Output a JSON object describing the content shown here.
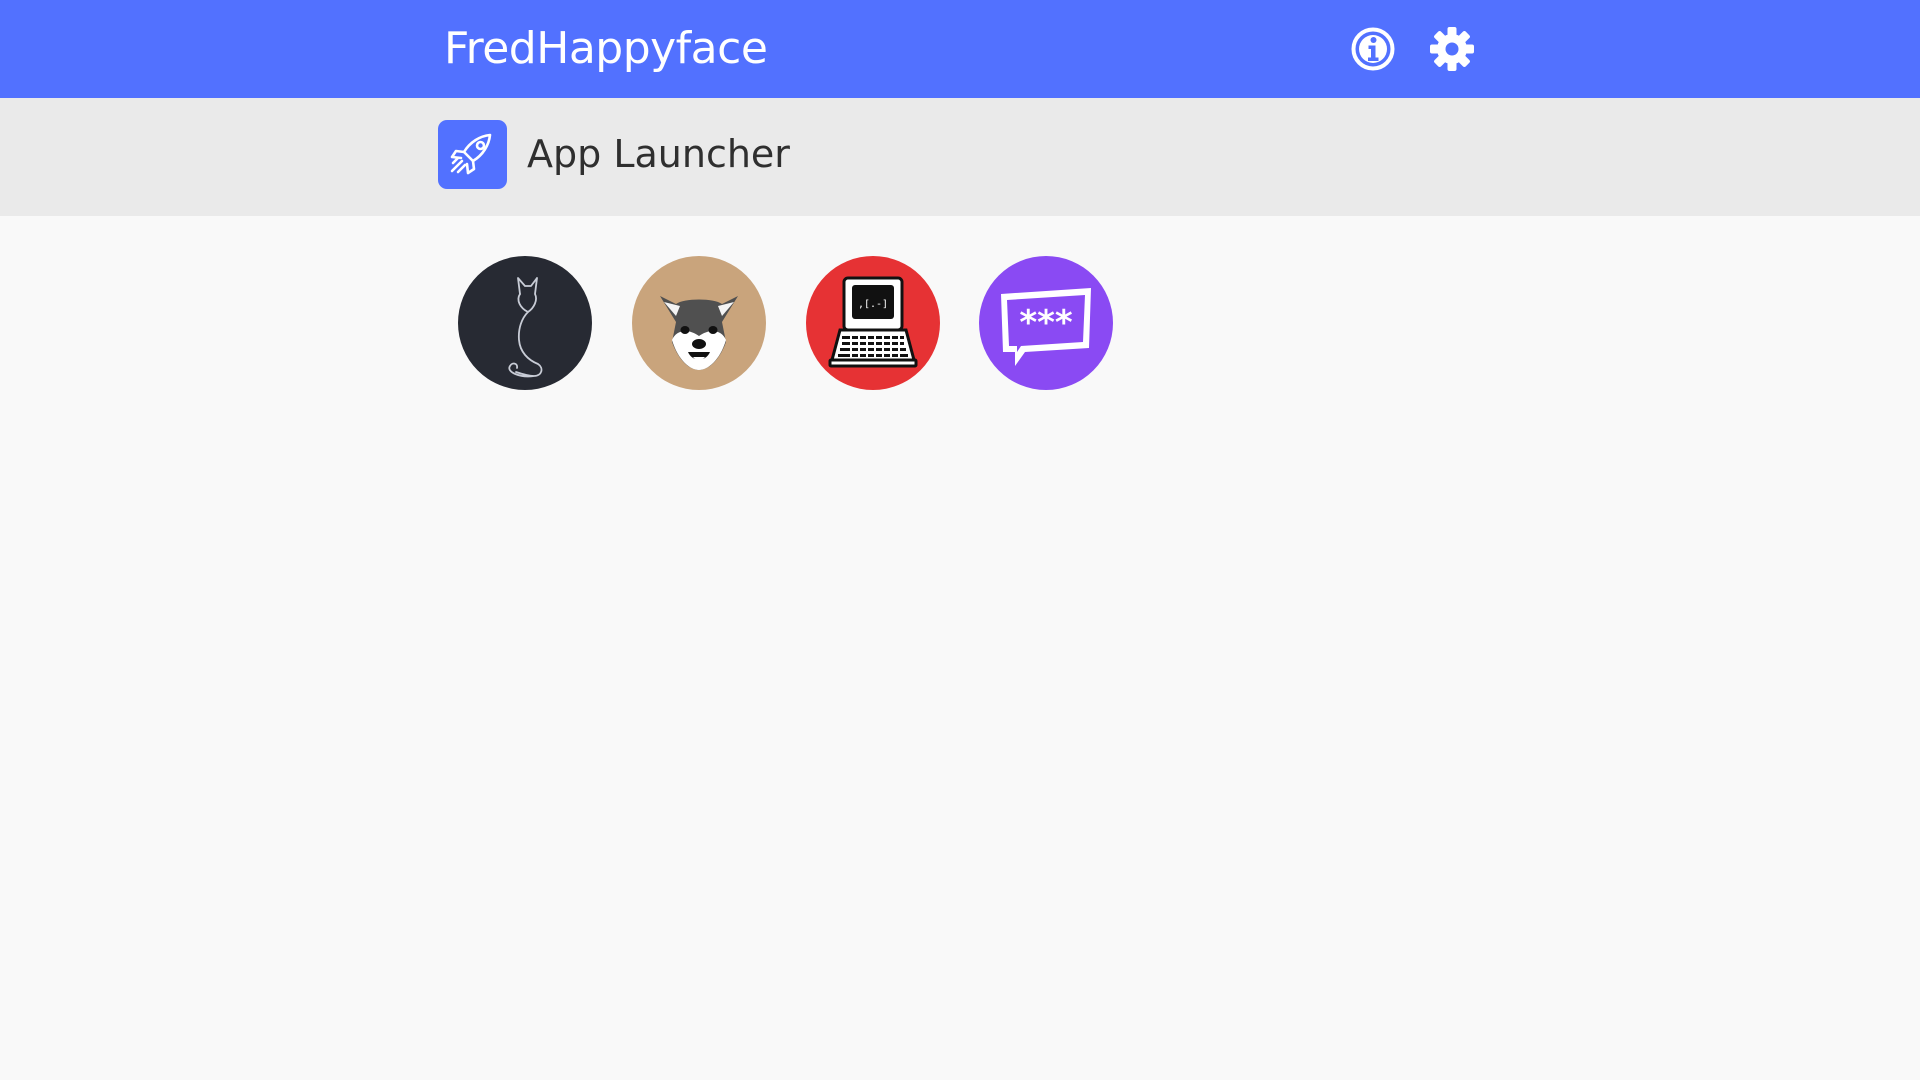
{
  "header": {
    "brand": "FredHappyface",
    "info_icon": "info-circle-icon",
    "settings_icon": "gear-icon",
    "background": "#5271ff"
  },
  "subheader": {
    "icon": "rocket-icon",
    "title": "App Launcher",
    "background": "#eaeaea"
  },
  "apps": [
    {
      "icon": "cat-silhouette-icon",
      "color": "#272a33"
    },
    {
      "icon": "shiba-dog-icon",
      "color": "#c9a47c"
    },
    {
      "icon": "retro-computer-icon",
      "color": "#e63234",
      "screen_text": ",[.-]"
    },
    {
      "icon": "password-chat-icon",
      "color": "#8a4af3",
      "bubble_text": "***"
    }
  ]
}
